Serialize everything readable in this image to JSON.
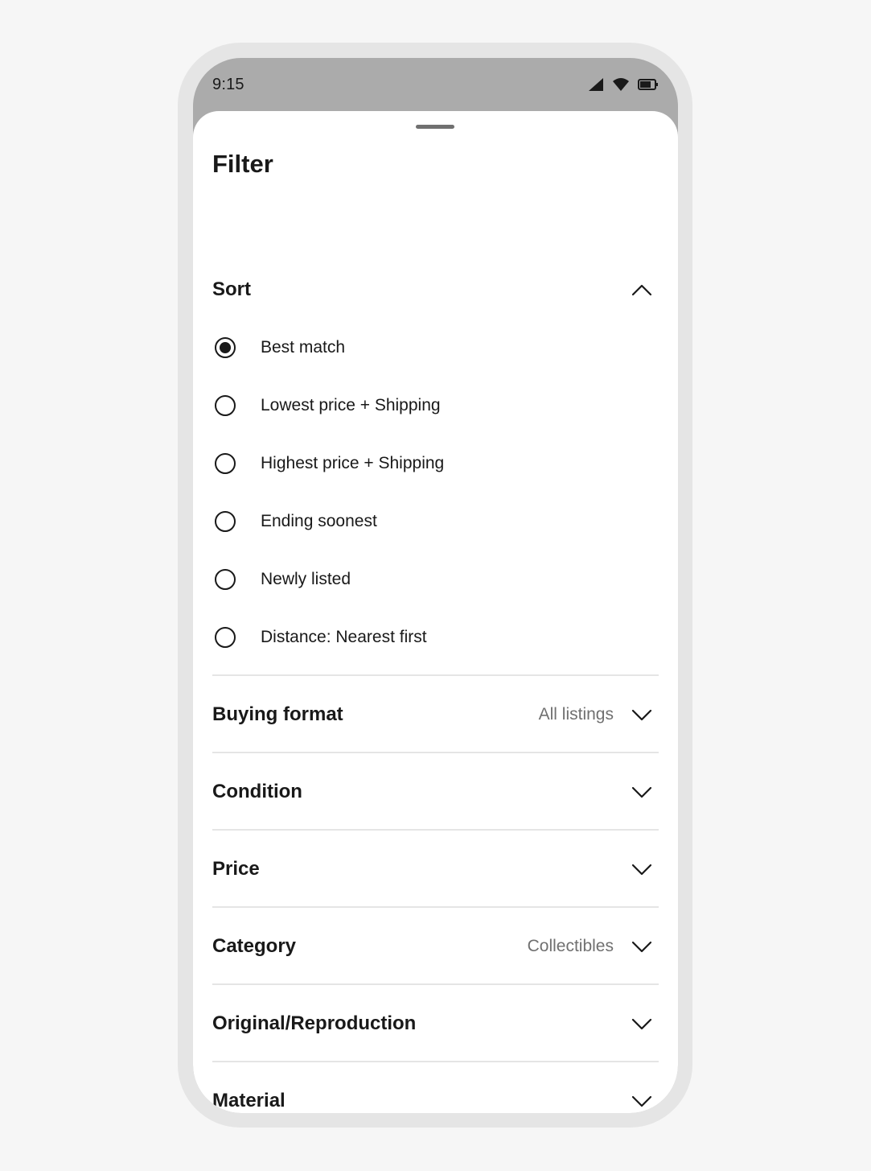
{
  "status_bar": {
    "time": "9:15",
    "icons": [
      "cellular-signal-icon",
      "wifi-icon",
      "battery-icon"
    ]
  },
  "sheet": {
    "title": "Filter"
  },
  "sort": {
    "label": "Sort",
    "expanded": true,
    "options": [
      {
        "label": "Best match",
        "selected": true
      },
      {
        "label": "Lowest price + Shipping",
        "selected": false
      },
      {
        "label": "Highest price + Shipping",
        "selected": false
      },
      {
        "label": "Ending soonest",
        "selected": false
      },
      {
        "label": "Newly listed",
        "selected": false
      },
      {
        "label": "Distance: Nearest first",
        "selected": false
      }
    ]
  },
  "sections": [
    {
      "label": "Buying format",
      "value": "All listings"
    },
    {
      "label": "Condition",
      "value": ""
    },
    {
      "label": "Price",
      "value": ""
    },
    {
      "label": "Category",
      "value": "Collectibles"
    },
    {
      "label": "Original/Reproduction",
      "value": ""
    },
    {
      "label": "Material",
      "value": ""
    }
  ],
  "colors": {
    "background": "#f6f6f6",
    "device_frame": "#e5e5e5",
    "status_bar": "#ababab",
    "sheet": "#ffffff",
    "text_primary": "#191919",
    "text_secondary": "#707070",
    "divider": "#e5e5e5"
  }
}
